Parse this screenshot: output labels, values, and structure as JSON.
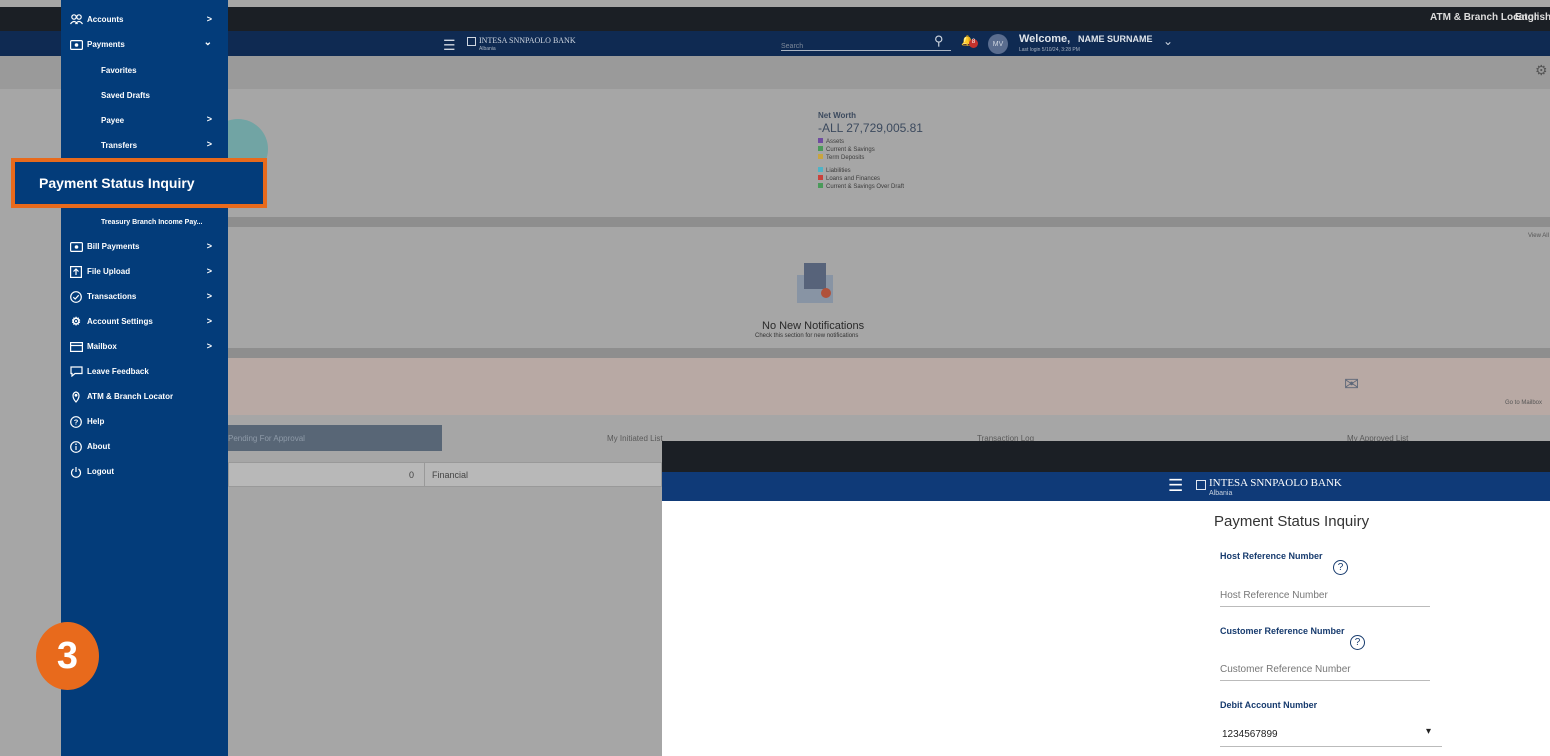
{
  "background": {
    "utility_links": [
      "ATM & Branch Locator",
      "English"
    ],
    "brand": "INTESA SNNPAOLO BANK",
    "brand_sub": "Albania",
    "search_placeholder": "Search",
    "avatar_initials": "MV",
    "notification_count": "8",
    "welcome": "Welcome,",
    "user_name": "NAME SURNAME",
    "last_login": "Last login 5/10/24, 3:28 PM",
    "net_worth_label": "Net Worth",
    "net_worth_value": "-ALL 27,729,005.81",
    "legend_assets": [
      "Assets",
      "Current & Savings",
      "Term Deposits"
    ],
    "legend_liabilities": [
      "Liabilities",
      "Loans and Finances",
      "Current & Savings Over Draft"
    ],
    "view_all": "View All",
    "no_notifications": "No New Notifications",
    "no_notifications_sub": "Check this section for new notifications",
    "go_to_mailbox": "Go to Mailbox",
    "tabs": [
      "Pending For Approval",
      "My Initiated List",
      "Transaction Log",
      "My Approved List"
    ],
    "row_count": "0",
    "row_type": "Financial"
  },
  "sidebar": {
    "accounts": "Accounts",
    "payments": "Payments",
    "favorites": "Favorites",
    "saved_drafts": "Saved Drafts",
    "payee": "Payee",
    "transfers": "Transfers",
    "treasury": "Treasury Branch Income Pay...",
    "bill_payments": "Bill Payments",
    "file_upload": "File Upload",
    "transactions": "Transactions",
    "account_settings": "Account Settings",
    "mailbox": "Mailbox",
    "leave_feedback": "Leave Feedback",
    "atm_locator": "ATM & Branch Locator",
    "help": "Help",
    "about": "About",
    "logout": "Logout"
  },
  "highlight_label": "Payment Status Inquiry",
  "step_number": "3",
  "form": {
    "brand": "INTESA SNNPAOLO BANK",
    "brand_sub": "Albania",
    "title": "Payment Status Inquiry",
    "host_ref_label": "Host Reference Number",
    "host_ref_placeholder": "Host Reference Number",
    "cust_ref_label": "Customer Reference Number",
    "cust_ref_placeholder": "Customer Reference Number",
    "debit_label": "Debit Account Number",
    "debit_value": "1234567899"
  },
  "colors": {
    "sidebar": "#033c7a",
    "accent": "#e86a1c",
    "navbar": "#0f2a52",
    "assets": "#6f4ca0",
    "savings": "#4a9a5a",
    "deposits": "#c9a540",
    "liabilities": "#4fb3c6",
    "loans": "#c9413b"
  }
}
